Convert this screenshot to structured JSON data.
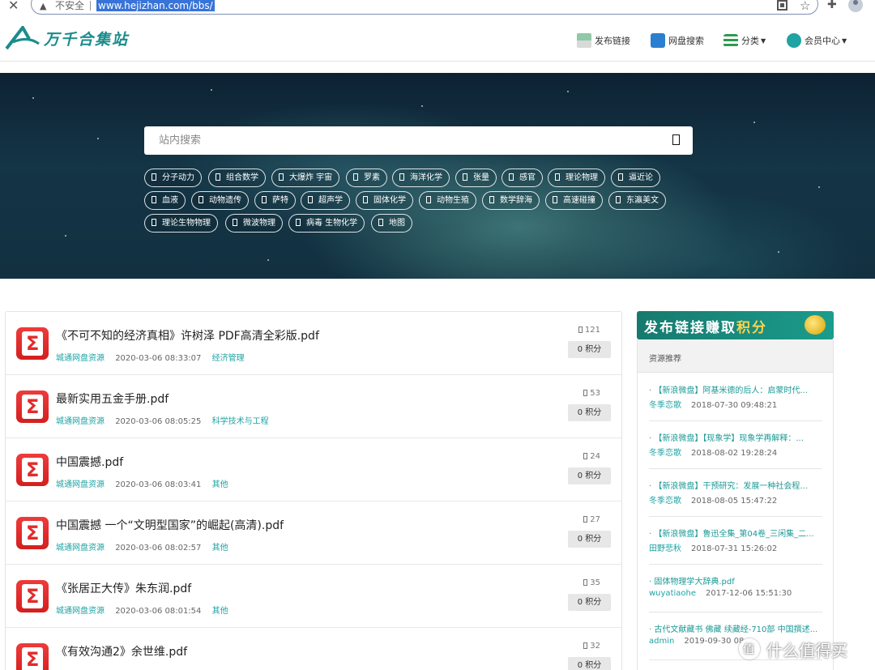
{
  "browser": {
    "insecure_label": "不安全",
    "url": "www.hejizhan.com/bbs/"
  },
  "header": {
    "logo_text": "万千合集站",
    "nav": {
      "publish": "发布链接",
      "pan_search": "网盘搜索",
      "category": "分类",
      "member": "会员中心"
    }
  },
  "search": {
    "placeholder": "站内搜索",
    "tags": [
      "分子动力",
      "组合数学",
      "大爆炸 宇宙",
      "罗素",
      "海洋化学",
      "张量",
      "感官",
      "理论物理",
      "逼近论",
      "血液",
      "动物遗传",
      "萨特",
      "超声学",
      "固体化学",
      "动物生殖",
      "数学辞海",
      "高速碰撞",
      "东瀛美文",
      "理论生物物理",
      "微波物理",
      "病毒 生物化学",
      "地图"
    ]
  },
  "list": [
    {
      "title": "《不可不知的经济真相》许树泽 PDF高清全彩版.pdf",
      "source": "城通网盘资源",
      "date": "2020-03-06 08:33:07",
      "category": "经济管理",
      "views": "121",
      "points": "0 积分"
    },
    {
      "title": "最新实用五金手册.pdf",
      "source": "城通网盘资源",
      "date": "2020-03-06 08:05:25",
      "category": "科学技术与工程",
      "views": "53",
      "points": "0 积分"
    },
    {
      "title": "中国震撼.pdf",
      "source": "城通网盘资源",
      "date": "2020-03-06 08:03:41",
      "category": "其他",
      "views": "24",
      "points": "0 积分"
    },
    {
      "title": "中国震撼 一个“文明型国家”的崛起(高清).pdf",
      "source": "城通网盘资源",
      "date": "2020-03-06 08:02:57",
      "category": "其他",
      "views": "27",
      "points": "0 积分"
    },
    {
      "title": "《张居正大传》朱东润.pdf",
      "source": "城通网盘资源",
      "date": "2020-03-06 08:01:54",
      "category": "其他",
      "views": "35",
      "points": "0 积分"
    },
    {
      "title": "《有效沟通2》余世维.pdf",
      "source": "",
      "date": "",
      "category": "",
      "views": "32",
      "points": "0 积分"
    }
  ],
  "sidebar": {
    "banner_main": "发布链接赚取",
    "banner_accent": "积分",
    "heading": "资源推荐",
    "items": [
      {
        "title": "· 【新浪微盘】阿基米德的后人：启蒙时代...",
        "author": "冬季恋歌",
        "date": "2018-07-30 09:48:21"
      },
      {
        "title": "· 【新浪微盘】【现象学】现象学再解释：...",
        "author": "冬季恋歌",
        "date": "2018-08-02 19:28:24"
      },
      {
        "title": "· 【新浪微盘】干预研究：发展一种社会程...",
        "author": "冬季恋歌",
        "date": "2018-08-05 15:47:22"
      },
      {
        "title": "· 【新浪微盘】鲁迅全集_第04卷_三闲集_二...",
        "author": "田野悲秋",
        "date": "2018-07-31 15:26:02"
      },
      {
        "title": "· 固体物理学大辞典.pdf",
        "author": "wuyatiaohe",
        "date": "2017-12-06 15:51:30"
      },
      {
        "title": "· 古代文献藏书 佛藏 续藏经-710部 中国撰述...",
        "author": "admin",
        "date": "2019-09-30 08"
      }
    ]
  },
  "watermark": "什么值得买",
  "colors": {
    "accent": "#1fa3a3",
    "pdf_red": "#e22b2b",
    "banner": "#167a6e"
  }
}
